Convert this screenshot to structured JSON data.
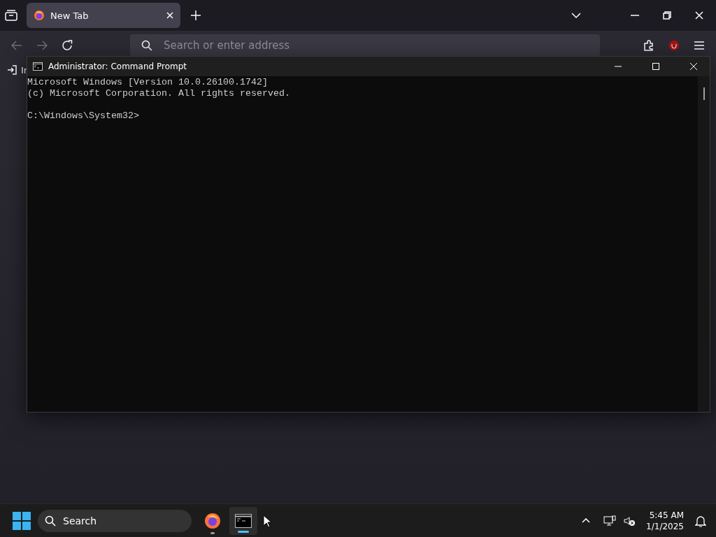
{
  "browser": {
    "tabs": [
      {
        "title": "New Tab",
        "selected": true
      }
    ],
    "address_bar": {
      "placeholder": "Search or enter address"
    },
    "bookmarks": [
      {
        "label": "Ir"
      }
    ]
  },
  "cmd_window": {
    "title": "Administrator: Command Prompt",
    "output": [
      "Microsoft Windows [Version 10.0.26100.1742]",
      "(c) Microsoft Corporation. All rights reserved."
    ],
    "prompt": "C:\\Windows\\System32>"
  },
  "taskbar": {
    "search": {
      "placeholder": "Search"
    },
    "apps": [
      {
        "kind": "firefox",
        "selected": false
      },
      {
        "kind": "terminal",
        "selected": true
      }
    ],
    "clock": {
      "time": "5:45 AM",
      "date": "1/1/2025"
    }
  }
}
